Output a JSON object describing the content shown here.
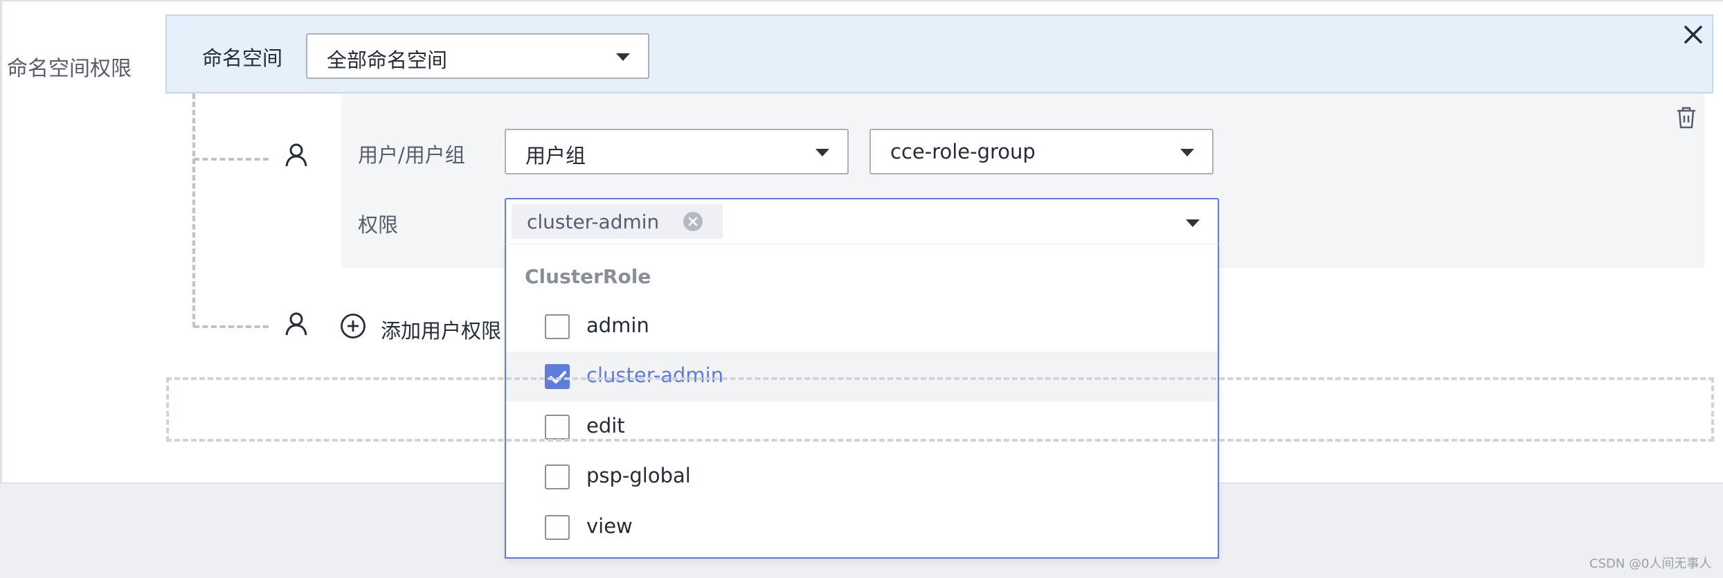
{
  "section_label": "命名空间权限",
  "namespace": {
    "label": "命名空间",
    "value": "全部命名空间"
  },
  "user_binding": {
    "user_label": "用户/用户组",
    "user_type_value": "用户组",
    "group_value": "cce-role-group",
    "permission_label": "权限",
    "selected_tag": "cluster-admin"
  },
  "dropdown": {
    "group_title": "ClusterRole",
    "options": [
      {
        "label": "admin",
        "checked": false
      },
      {
        "label": "cluster-admin",
        "checked": true
      },
      {
        "label": "edit",
        "checked": false
      },
      {
        "label": "psp-global",
        "checked": false
      },
      {
        "label": "view",
        "checked": false
      }
    ]
  },
  "add_user_permission": "添加用户权限",
  "watermark": "CSDN @0人间无事人",
  "colors": {
    "accent": "#5e7ce0",
    "header_bg": "#e6f0fa",
    "row_bg": "#f4f5f7"
  },
  "icons": [
    "close-icon",
    "delete-icon",
    "person-icon",
    "add-circle-icon",
    "caret-down-icon",
    "clear-tag-icon",
    "check-icon"
  ]
}
